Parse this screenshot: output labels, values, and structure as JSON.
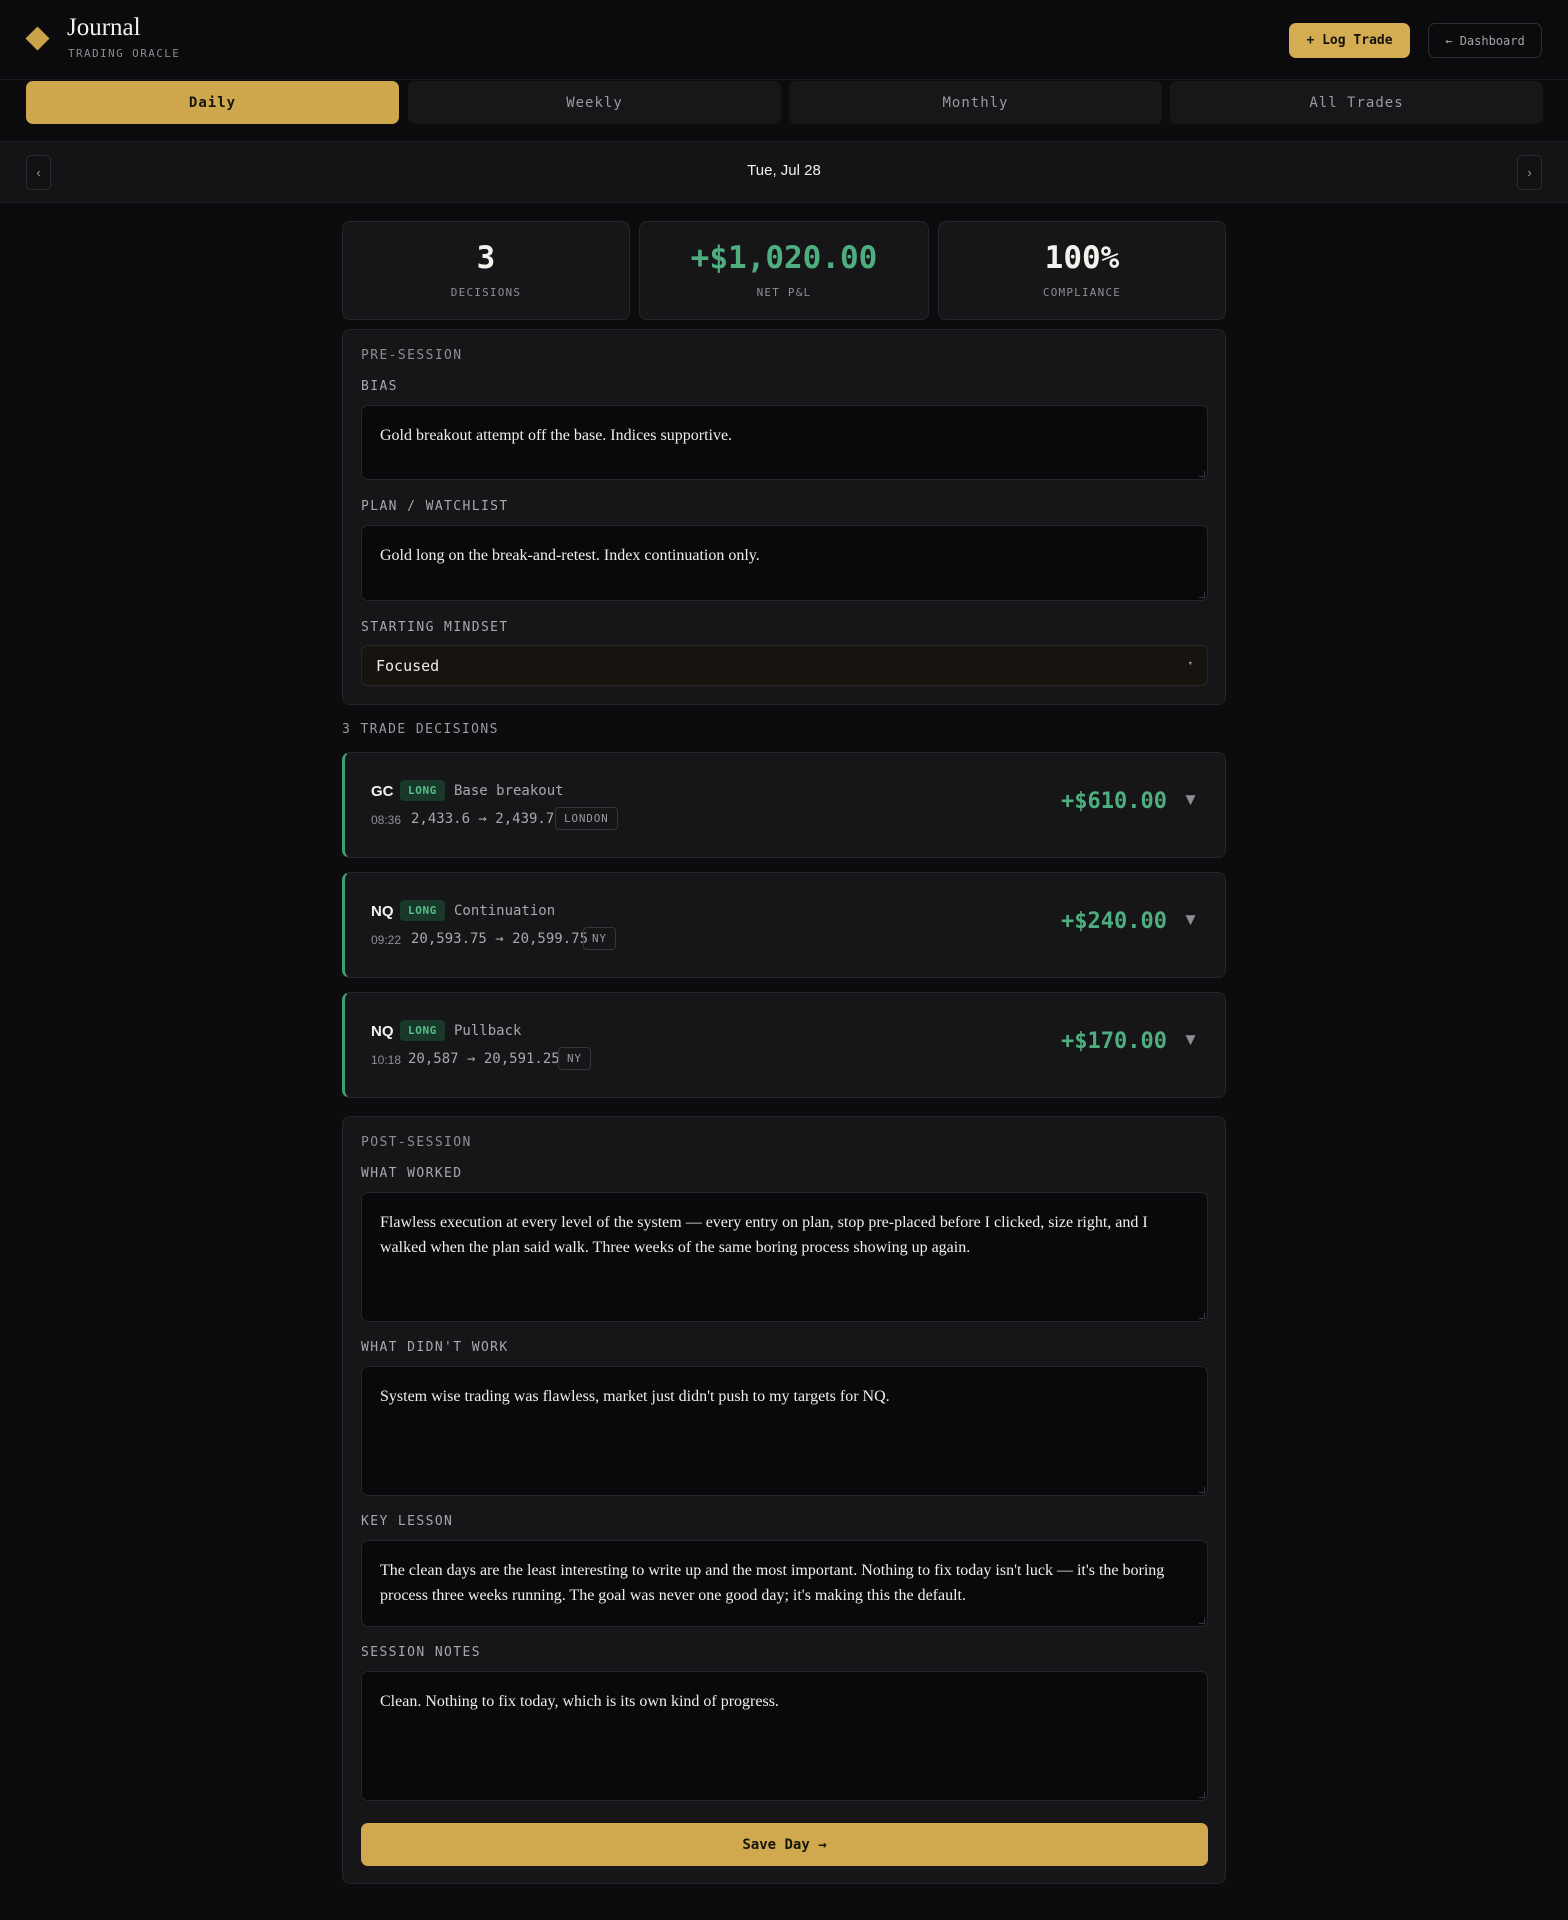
{
  "app": {
    "title": "Journal",
    "subtitle": "TRADING ORACLE"
  },
  "header": {
    "log_trade": "+ Log Trade",
    "dashboard": "← Dashboard"
  },
  "tabs": [
    {
      "label": "Daily",
      "active": true
    },
    {
      "label": "Weekly",
      "active": false
    },
    {
      "label": "Monthly",
      "active": false
    },
    {
      "label": "All Trades",
      "active": false
    }
  ],
  "date_nav": {
    "prev": "‹",
    "date": "Tue, Jul 28",
    "next": "›"
  },
  "stats": [
    {
      "value": "3",
      "label": "DECISIONS"
    },
    {
      "value": "+$1,020.00",
      "label": "NET P&L"
    },
    {
      "value": "100%",
      "label": "COMPLIANCE"
    }
  ],
  "pre_session": {
    "title": "PRE-SESSION",
    "bias_label": "BIAS",
    "bias_value": "Gold breakout attempt off the base. Indices supportive.",
    "plan_label": "PLAN / WATCHLIST",
    "plan_value": "Gold long on the break-and-retest. Index continuation only.",
    "mindset_label": "STARTING MINDSET",
    "mindset_value": "Focused",
    "mindset_caret": "▾"
  },
  "trades_title": "3 TRADE DECISIONS",
  "trades": [
    {
      "symbol": "GC",
      "side": "LONG",
      "setup": "Base breakout",
      "time": "08:36",
      "prices": "2,433.6 → 2,439.7",
      "session": "LONDON",
      "pnl": "+$610.00",
      "chevron": "▼"
    },
    {
      "symbol": "NQ",
      "side": "LONG",
      "setup": "Continuation",
      "time": "09:22",
      "prices": "20,593.75 → 20,599.75",
      "session": "NY",
      "pnl": "+$240.00",
      "chevron": "▼"
    },
    {
      "symbol": "NQ",
      "side": "LONG",
      "setup": "Pullback",
      "time": "10:18",
      "prices": "20,587 → 20,591.25",
      "session": "NY",
      "pnl": "+$170.00",
      "chevron": "▼"
    }
  ],
  "post_session": {
    "title": "POST-SESSION",
    "worked_label": "WHAT WORKED",
    "worked_value": "Flawless execution at every level of the system — every entry on plan, stop pre-placed before I clicked, size right, and I walked when the plan said walk. Three weeks of the same boring process showing up again.",
    "didnt_label": "WHAT DIDN'T WORK",
    "didnt_value": "System wise trading was flawless, market just didn't push to my targets for NQ.",
    "lesson_label": "KEY LESSON",
    "lesson_value": "The clean days are the least interesting to write up and the most important. Nothing to fix today isn't luck — it's the boring process three weeks running. The goal was never one good day; it's making this the default.",
    "notes_label": "SESSION NOTES",
    "notes_value": "Clean. Nothing to fix today, which is its own kind of progress.",
    "save": "Save Day →"
  },
  "colors": {
    "accent": "#d0a84d",
    "profit": "#4fae80",
    "background": "#0c0c0e",
    "panel": "#161618"
  }
}
